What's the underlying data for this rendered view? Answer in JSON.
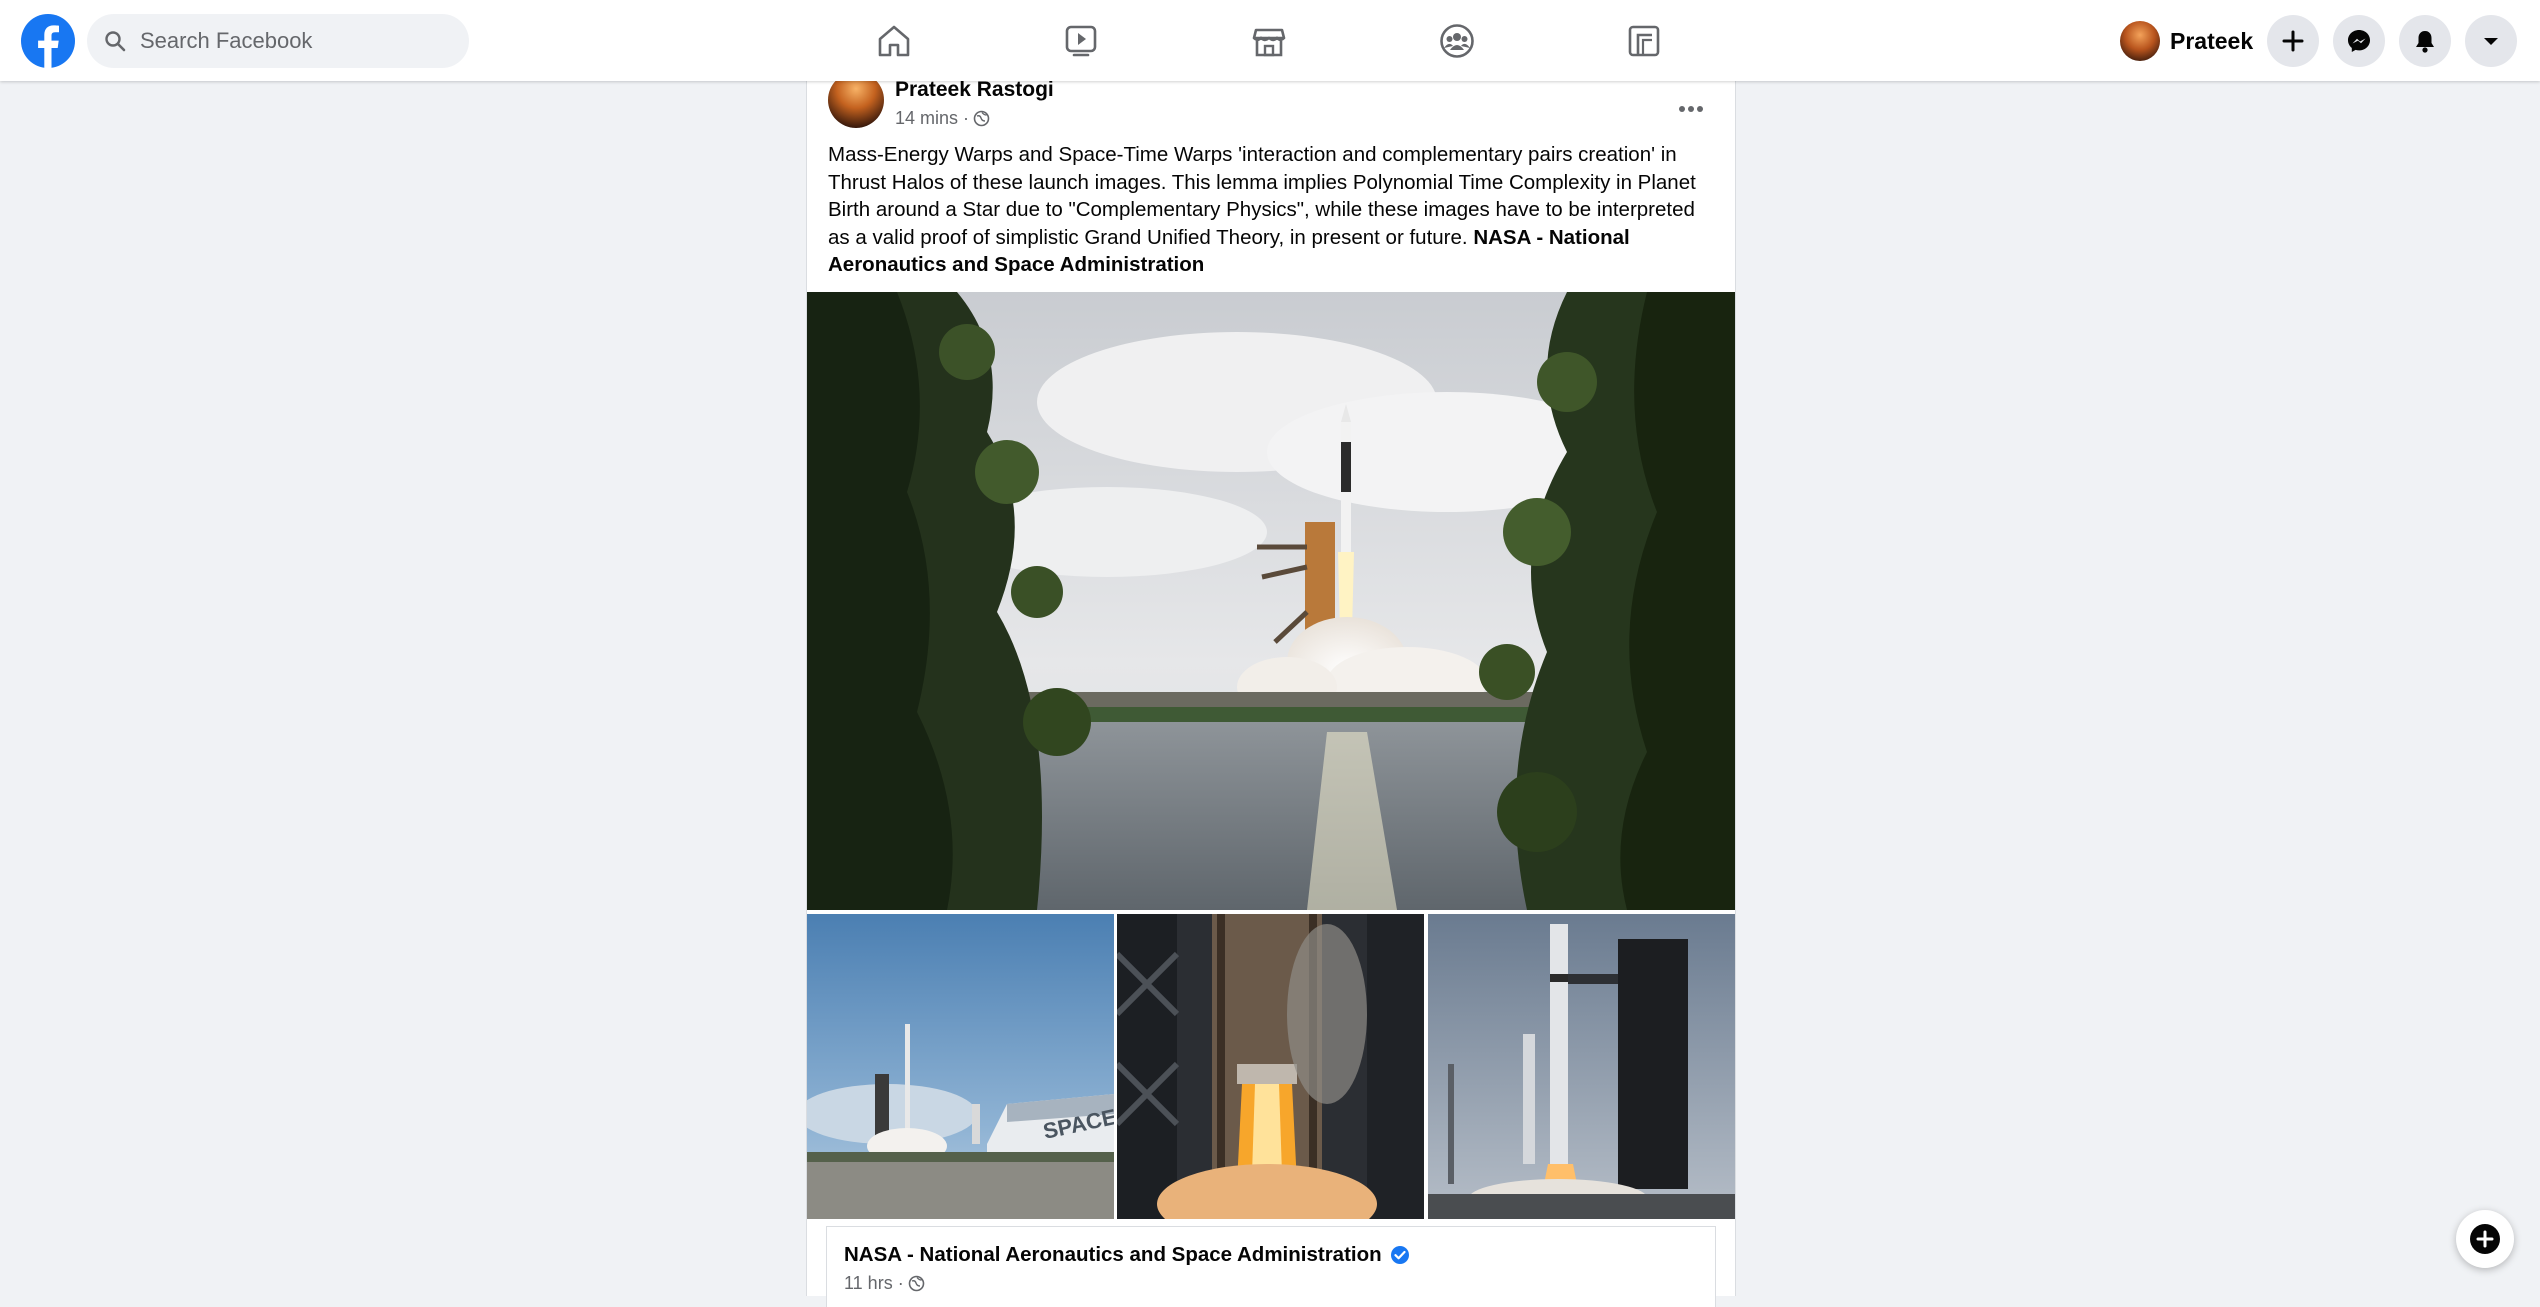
{
  "topbar": {
    "logo_icon": "facebook-logo-icon",
    "search_placeholder": "Search Facebook",
    "nav": [
      {
        "icon": "home-icon"
      },
      {
        "icon": "watch-video-icon"
      },
      {
        "icon": "marketplace-icon"
      },
      {
        "icon": "groups-icon"
      },
      {
        "icon": "gaming-icon"
      }
    ],
    "profile_name": "Prateek",
    "actions": [
      {
        "icon": "create-plus-icon"
      },
      {
        "icon": "messenger-icon"
      },
      {
        "icon": "notifications-bell-icon"
      },
      {
        "icon": "account-caret-icon"
      }
    ]
  },
  "post": {
    "author": "Prateek Rastogi",
    "time": "14 mins ·",
    "privacy_icon": "globe-icon",
    "text": "Mass-Energy Warps and Space-Time Warps 'interaction and complementary pairs creation' in Thrust Halos of these launch images. This lemma implies Polynomial Time Complexity in Planet Birth around a Star due to \"Complementary Physics\", while these images have to be interpreted as a valid proof of simplistic Grand Unified Theory, in present or future.",
    "text_tag": "NASA - National Aeronautics and Space Administration",
    "photo_texts": {
      "spacex_building": "SPACEX"
    },
    "shared": {
      "page_name": "NASA - National Aeronautics and Space Administration",
      "verified_icon": "verified-badge-icon",
      "time": "11 hrs ·"
    }
  },
  "colors": {
    "brand": "#1877f2",
    "background": "#f0f2f5",
    "secondary_text": "#65676b"
  }
}
